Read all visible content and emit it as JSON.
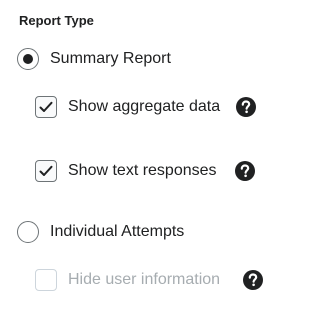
{
  "report_type": {
    "heading": "Report Type",
    "options": [
      {
        "label": "Summary Report",
        "selected": true
      },
      {
        "label": "Individual Attempts",
        "selected": false
      }
    ],
    "summary_options": [
      {
        "label": "Show aggregate data",
        "checked": true,
        "disabled": false,
        "help_icon": "question-circle-icon"
      },
      {
        "label": "Show text responses",
        "checked": true,
        "disabled": false,
        "help_icon": "question-circle-icon"
      }
    ],
    "attempt_options": [
      {
        "label": "Hide user information",
        "checked": false,
        "disabled": true,
        "help_icon": "question-circle-icon"
      }
    ]
  },
  "colors": {
    "text": "#202122",
    "border": "#6e7477",
    "disabled_text": "#a6acb0",
    "disabled_border": "#cdd5dc"
  }
}
